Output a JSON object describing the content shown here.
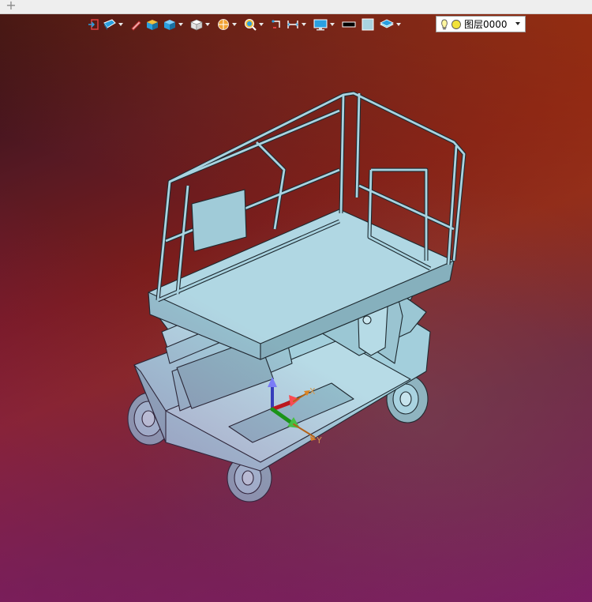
{
  "tabbar": {
    "add_tab_symbol": "+"
  },
  "toolbar": {
    "buttons": [
      {
        "icon": "exit-sketch-icon",
        "has_dropdown": false
      },
      {
        "icon": "view-style-icon",
        "has_dropdown": true
      },
      {
        "icon": "pencil-icon",
        "has_dropdown": false
      },
      {
        "icon": "box-shaded-icon",
        "has_dropdown": false
      },
      {
        "icon": "box-blue-icon",
        "has_dropdown": true
      },
      {
        "icon": "cube-white-icon",
        "has_dropdown": true
      },
      {
        "icon": "section-view-icon",
        "has_dropdown": true
      },
      {
        "icon": "zoom-view-icon",
        "has_dropdown": true
      },
      {
        "icon": "view-rotate-icon",
        "has_dropdown": false
      },
      {
        "icon": "measure-icon",
        "has_dropdown": true
      },
      {
        "icon": "display-monitor-icon",
        "has_dropdown": true
      },
      {
        "icon": "line-color-icon",
        "has_dropdown": false
      },
      {
        "icon": "fill-color-icon",
        "has_dropdown": false
      },
      {
        "icon": "layers-icon",
        "has_dropdown": true
      }
    ],
    "layer_select": {
      "value": "图层0000"
    }
  },
  "triad": {
    "x_label": "X",
    "y_label": "Y"
  },
  "colors": {
    "model_fill": "#a9d3e0",
    "model_stroke": "#1e2a30",
    "toolbar_accent": "#2aa0e0"
  }
}
